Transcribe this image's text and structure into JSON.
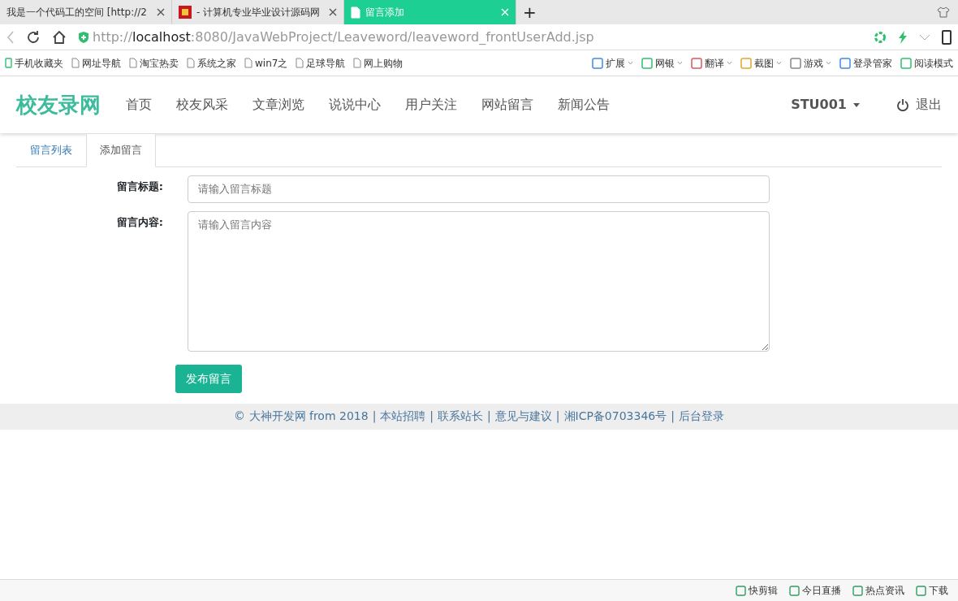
{
  "browser_tabs": [
    {
      "title": "我是一个代码工的空间 [http://2",
      "selected": false,
      "kind": "plain"
    },
    {
      "title": "- 计算机专业毕业设计源码网",
      "selected": false,
      "kind": "favicon"
    },
    {
      "title": "留言添加",
      "selected": true,
      "kind": "page"
    }
  ],
  "new_tab": "+",
  "address": {
    "scheme": "http://",
    "host": "localhost",
    "path": ":8080/JavaWebProject/Leaveword/leaveword_frontUserAdd.jsp"
  },
  "bookmarks": [
    {
      "label": "手机收藏夹",
      "kind": "phone"
    },
    {
      "label": "网址导航",
      "kind": "page"
    },
    {
      "label": "淘宝热卖",
      "kind": "page"
    },
    {
      "label": "系统之家",
      "kind": "page"
    },
    {
      "label": "win7之",
      "kind": "page"
    },
    {
      "label": "足球导航",
      "kind": "page"
    },
    {
      "label": "网上购物",
      "kind": "page"
    }
  ],
  "toolbar_tools": [
    {
      "label": "扩展",
      "dropdown": true
    },
    {
      "label": "网银",
      "dropdown": true
    },
    {
      "label": "翻译",
      "dropdown": true
    },
    {
      "label": "截图",
      "dropdown": true
    },
    {
      "label": "游戏",
      "dropdown": true
    },
    {
      "label": "登录管家",
      "dropdown": false
    },
    {
      "label": "阅读模式",
      "dropdown": false
    }
  ],
  "site": {
    "brand": "校友录网",
    "nav": [
      "首页",
      "校友风采",
      "文章浏览",
      "说说中心",
      "用户关注",
      "网站留言",
      "新闻公告"
    ],
    "user": "STU001",
    "logout": "退出"
  },
  "tabs": [
    {
      "label": "留言列表",
      "selected": false
    },
    {
      "label": "添加留言",
      "selected": true
    }
  ],
  "form": {
    "fields": [
      {
        "label": "留言标题:",
        "placeholder": "请输入留言标题",
        "kind": "input"
      },
      {
        "label": "留言内容:",
        "placeholder": "请输入留言内容",
        "kind": "textarea"
      }
    ],
    "submit": "发布留言"
  },
  "footer": {
    "separator": "|",
    "items": [
      "© 大神开发网 from 2018",
      "本站招聘",
      "联系站长",
      "意见与建议",
      "湘ICP备0703346号",
      "后台登录"
    ]
  },
  "status_bar": [
    "快剪辑",
    "今日直播",
    "热点资讯",
    "下载"
  ]
}
